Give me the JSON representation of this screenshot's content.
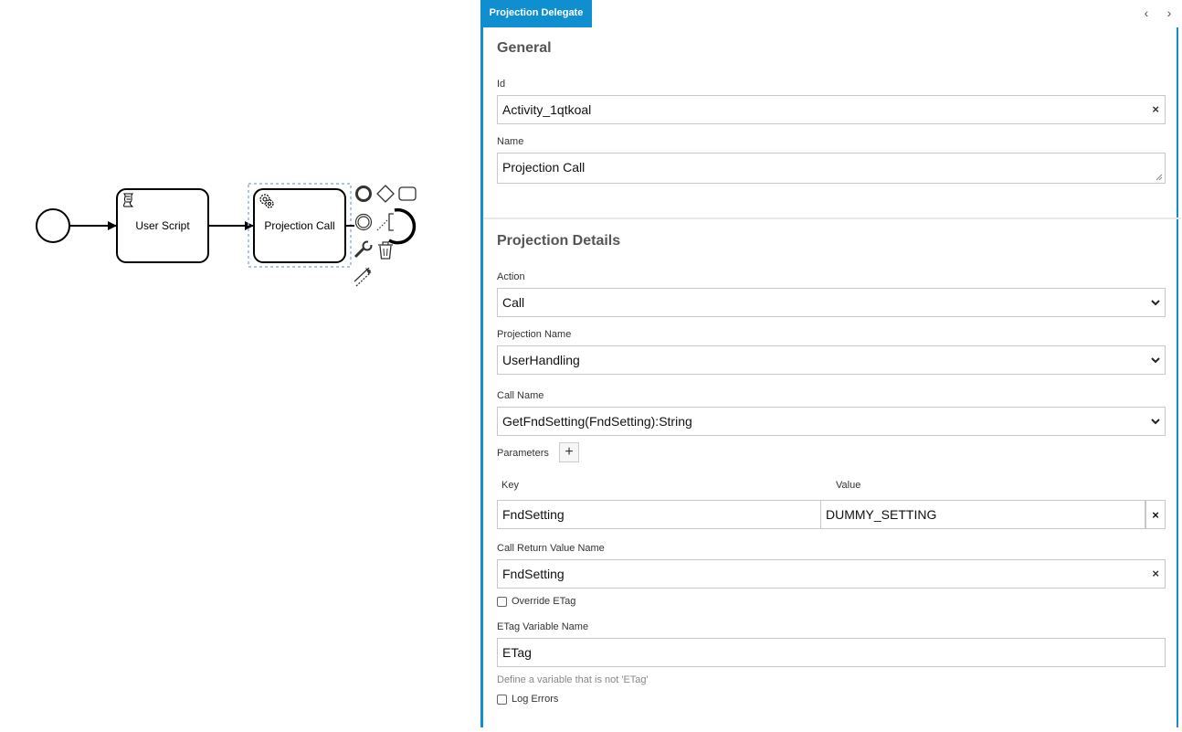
{
  "diagram": {
    "tasks": [
      {
        "label": "User Script",
        "type": "script-task"
      },
      {
        "label": "Projection Call",
        "type": "service-task",
        "selected": true
      }
    ]
  },
  "panel": {
    "tab_label": "Projection Delegate",
    "nav_prev": "‹",
    "nav_next": "›",
    "general": {
      "title": "General",
      "id_label": "Id",
      "id_value": "Activity_1qtkoal",
      "name_label": "Name",
      "name_value": "Projection Call"
    },
    "details": {
      "title": "Projection Details",
      "action_label": "Action",
      "action_value": "Call",
      "projection_name_label": "Projection Name",
      "projection_name_value": "UserHandling",
      "call_name_label": "Call Name",
      "call_name_value": "GetFndSetting(FndSetting):String",
      "parameters_label": "Parameters",
      "add_symbol": "+",
      "key_header": "Key",
      "value_header": "Value",
      "params": [
        {
          "key": "FndSetting",
          "value": "DUMMY_SETTING"
        }
      ],
      "return_label": "Call Return Value Name",
      "return_value": "FndSetting",
      "override_etag_label": "Override ETag",
      "etag_var_label": "ETag Variable Name",
      "etag_var_value": "ETag",
      "etag_hint": "Define a variable that is not 'ETag'",
      "log_errors_label": "Log Errors"
    },
    "clear_symbol": "×"
  },
  "colors": {
    "accent": "#0f8fd0",
    "selection": "#8fb2e6"
  }
}
